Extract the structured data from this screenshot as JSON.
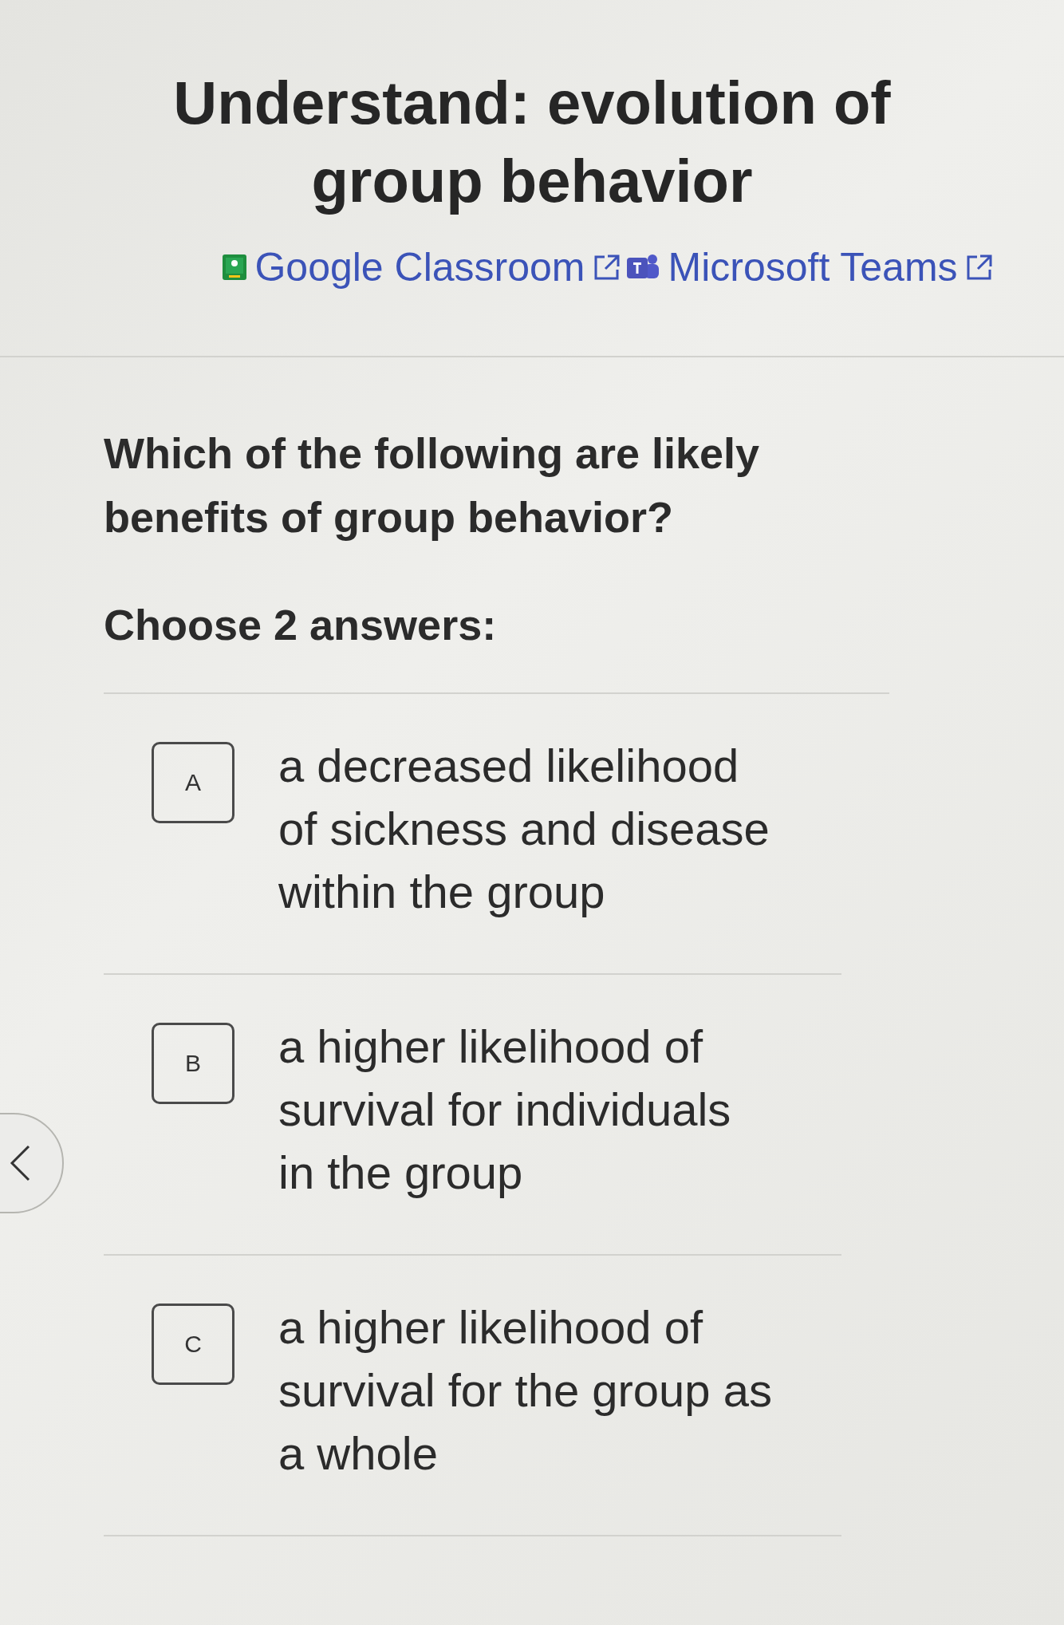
{
  "header": {
    "title": "Understand: evolution of group behavior",
    "links": [
      {
        "label": "Google Classroom"
      },
      {
        "label": "Microsoft Teams"
      }
    ]
  },
  "question": {
    "prompt": "Which of the following are likely benefits of group behavior?",
    "instruction": "Choose 2 answers:"
  },
  "choices": [
    {
      "letter": "A",
      "text": "a decreased likelihood of sickness and disease within the group",
      "selected": false
    },
    {
      "letter": "B",
      "text": "a higher likelihood of survival for individuals in the group",
      "selected": false
    },
    {
      "letter": "C",
      "text": "a higher likelihood of survival for the group as a whole",
      "selected": false
    }
  ]
}
